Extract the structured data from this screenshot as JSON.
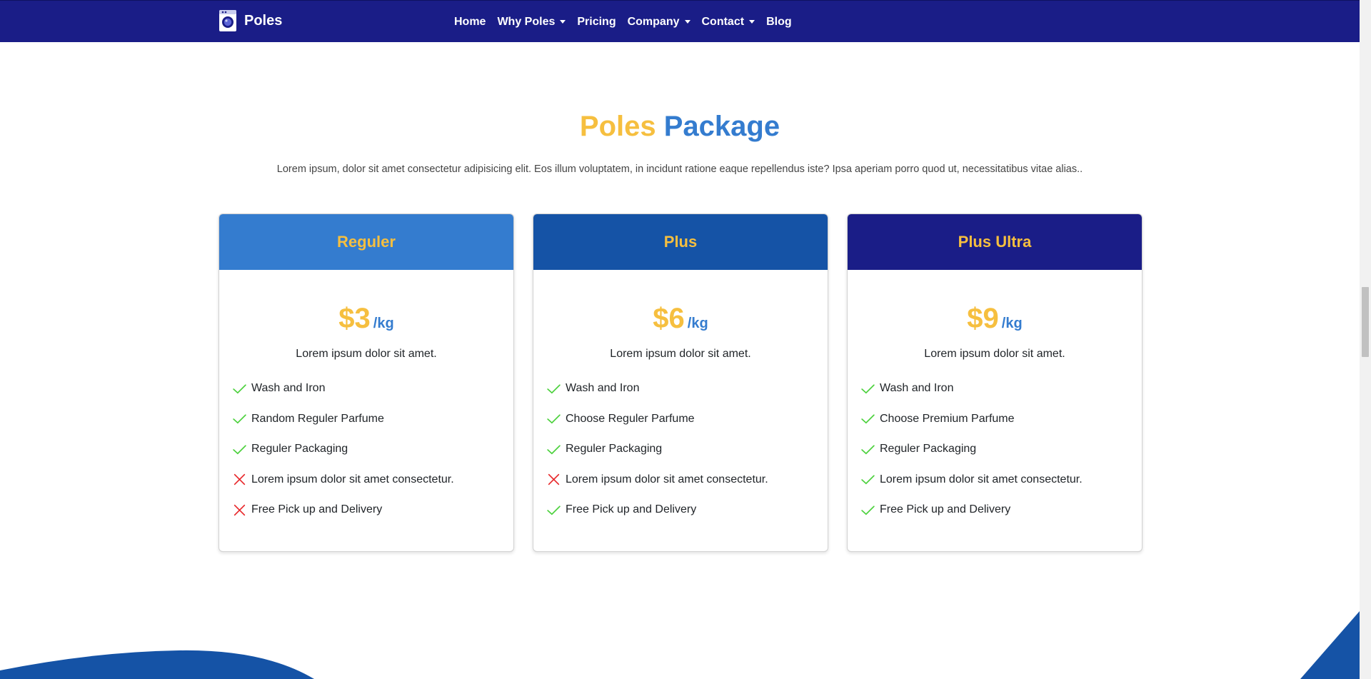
{
  "brand": {
    "name": "Poles",
    "logo_icon": "washing-machine-icon"
  },
  "nav": {
    "items": [
      {
        "label": "Home",
        "dropdown": false
      },
      {
        "label": "Why Poles",
        "dropdown": true
      },
      {
        "label": "Pricing",
        "dropdown": false
      },
      {
        "label": "Company",
        "dropdown": true
      },
      {
        "label": "Contact",
        "dropdown": true
      },
      {
        "label": "Blog",
        "dropdown": false
      }
    ]
  },
  "section": {
    "title_part1": "Poles",
    "title_part2": "Package",
    "description": "Lorem ipsum, dolor sit amet consectetur adipisicing elit. Eos illum voluptatem, in incidunt ratione eaque repellendus iste? Ipsa aperiam porro quod ut, necessitatibus vitae alias.."
  },
  "plans": [
    {
      "name": "Reguler",
      "header_color": "#347ccf",
      "price": "$3",
      "unit": "/kg",
      "tagline": "Lorem ipsum dolor sit amet.",
      "features": [
        {
          "label": "Wash and Iron",
          "included": true
        },
        {
          "label": "Random Reguler Parfume",
          "included": true
        },
        {
          "label": "Reguler Packaging",
          "included": true
        },
        {
          "label": "Lorem ipsum dolor sit amet consectetur.",
          "included": false
        },
        {
          "label": "Free Pick up and Delivery",
          "included": false
        }
      ]
    },
    {
      "name": "Plus",
      "header_color": "#1553a6",
      "price": "$6",
      "unit": "/kg",
      "tagline": "Lorem ipsum dolor sit amet.",
      "features": [
        {
          "label": "Wash and Iron",
          "included": true
        },
        {
          "label": "Choose Reguler Parfume",
          "included": true
        },
        {
          "label": "Reguler Packaging",
          "included": true
        },
        {
          "label": "Lorem ipsum dolor sit amet consectetur.",
          "included": false
        },
        {
          "label": "Free Pick up and Delivery",
          "included": true
        }
      ]
    },
    {
      "name": "Plus Ultra",
      "header_color": "#1a1d87",
      "price": "$9",
      "unit": "/kg",
      "tagline": "Lorem ipsum dolor sit amet.",
      "features": [
        {
          "label": "Wash and Iron",
          "included": true
        },
        {
          "label": "Choose Premium Parfume",
          "included": true
        },
        {
          "label": "Reguler Packaging",
          "included": true
        },
        {
          "label": "Lorem ipsum dolor sit amet consectetur.",
          "included": true
        },
        {
          "label": "Free Pick up and Delivery",
          "included": true
        }
      ]
    }
  ],
  "colors": {
    "navbar": "#1a1d87",
    "accent_yellow": "#f6bf3f",
    "accent_blue": "#347ccf",
    "check": "#4cd13d",
    "cross": "#e8282b",
    "wave": "#1553a6"
  },
  "icons": {
    "included": "check-icon",
    "excluded": "cross-icon"
  }
}
